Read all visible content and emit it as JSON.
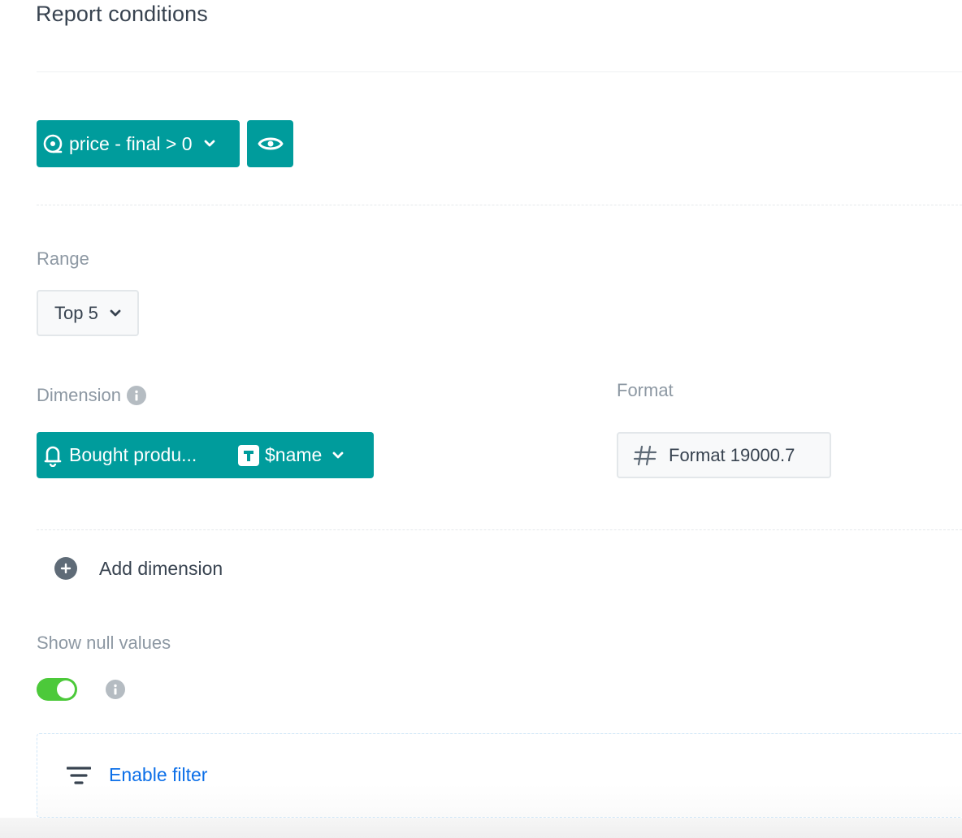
{
  "header": {
    "title": "Report conditions"
  },
  "condition": {
    "label": "price - final > 0",
    "icon": "event-condition-icon",
    "dropdown_icon": "chevron-down-icon",
    "preview_icon": "eye-icon"
  },
  "range": {
    "label": "Range",
    "selected": "Top 5"
  },
  "dimension": {
    "label": "Dimension",
    "info_icon": "info-icon",
    "event_label": "Bought produ...",
    "event_icon": "bell-icon",
    "param_type_icon": "text-type-icon",
    "param_label": "$name"
  },
  "format": {
    "label": "Format",
    "value": "Format 19000.7",
    "icon": "hash-icon"
  },
  "add_dimension": {
    "label": "Add dimension",
    "icon": "plus-circle-icon"
  },
  "null_values": {
    "label": "Show null values",
    "enabled": true,
    "toggle_color": "#4cc93a"
  },
  "filter": {
    "label": "Enable filter",
    "icon": "filter-icon"
  },
  "colors": {
    "accent": "#009c9c",
    "link": "#0c6fe8",
    "text": "#384350",
    "muted": "#8d98a3"
  }
}
